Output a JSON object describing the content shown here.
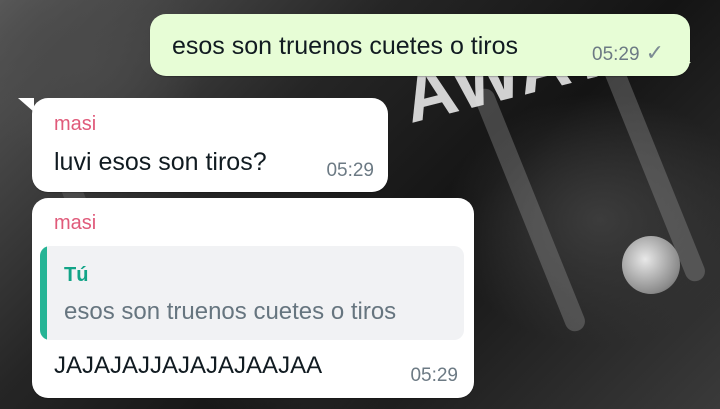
{
  "messages": [
    {
      "direction": "outgoing",
      "text": "esos son truenos cuetes o tiros",
      "time": "05:29",
      "status": "sent",
      "status_icon": "single-check-icon"
    },
    {
      "direction": "incoming",
      "sender": "masi",
      "text": "luvi esos son tiros?",
      "time": "05:29"
    },
    {
      "direction": "incoming",
      "sender": "masi",
      "quoted": {
        "author": "Tú",
        "text": "esos son truenos cuetes o tiros"
      },
      "text": "JAJAJAJJAJAJAJAAJAA",
      "time": "05:29"
    }
  ],
  "colors": {
    "outgoing_bubble": "#e7fdd6",
    "incoming_bubble": "#ffffff",
    "sender_name": "#e05a7a",
    "quote_accent": "#25b495"
  }
}
